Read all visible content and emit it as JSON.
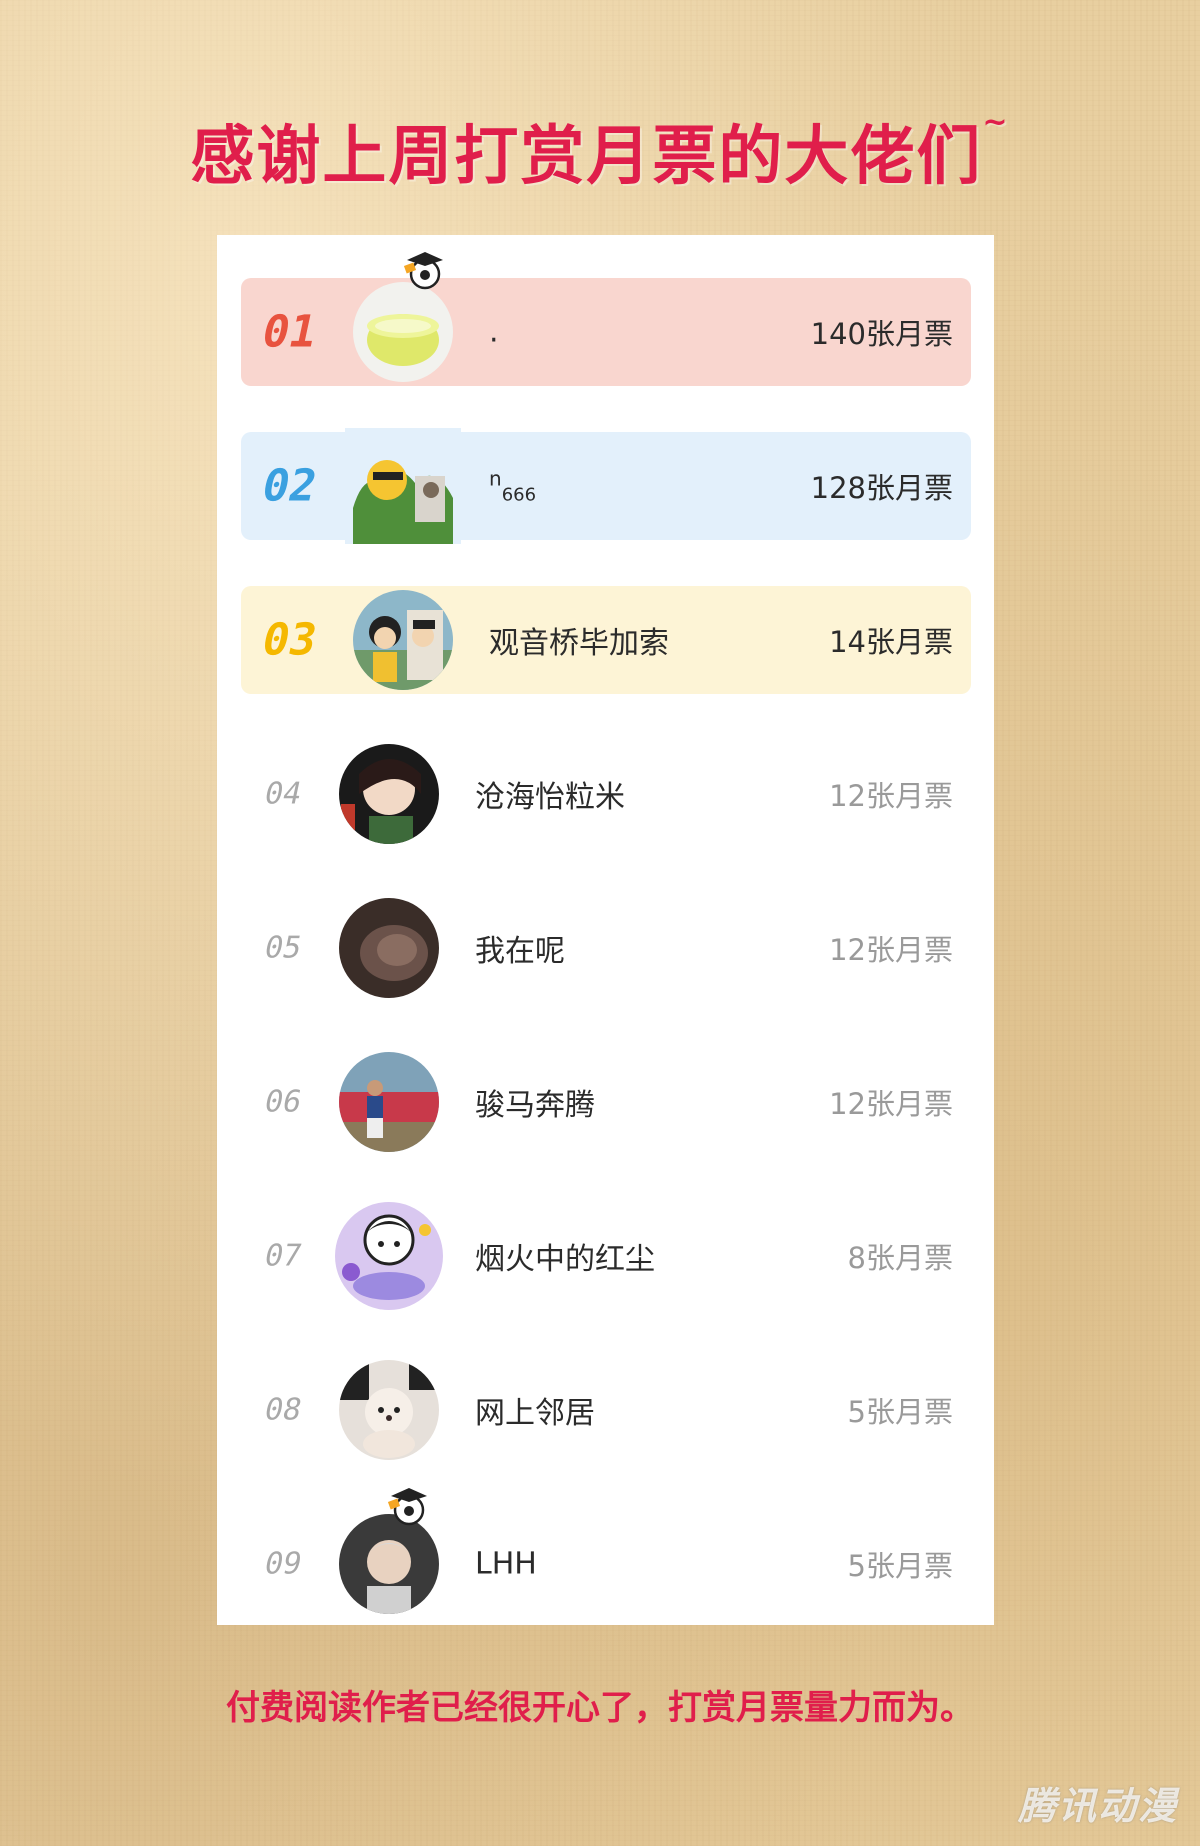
{
  "title": "感谢上周打赏月票的大佬们",
  "title_tilde": "~",
  "footer": "付费阅读作者已经很开心了，打赏月票量力而为。",
  "watermark": "腾讯动漫",
  "colors": {
    "title": "#e01e4b",
    "rank1": "#e8533f",
    "rank2": "#3aa0e0",
    "rank3": "#f5b800",
    "rank_plain": "#a9a9a9"
  },
  "ranking": [
    {
      "rank": "01",
      "name": ".",
      "votes": "140张月票"
    },
    {
      "rank": "02",
      "name": "n",
      "name_sub": "666",
      "votes": "128张月票"
    },
    {
      "rank": "03",
      "name": "观音桥毕加索",
      "votes": "14张月票"
    },
    {
      "rank": "04",
      "name": "沧海怡粒米",
      "votes": "12张月票"
    },
    {
      "rank": "05",
      "name": "我在呢",
      "votes": "12张月票"
    },
    {
      "rank": "06",
      "name": "骏马奔腾",
      "votes": "12张月票"
    },
    {
      "rank": "07",
      "name": "烟火中的红尘",
      "votes": "8张月票"
    },
    {
      "rank": "08",
      "name": "网上邻居",
      "votes": "5张月票"
    },
    {
      "rank": "09",
      "name": "LHH",
      "votes": "5张月票"
    }
  ]
}
